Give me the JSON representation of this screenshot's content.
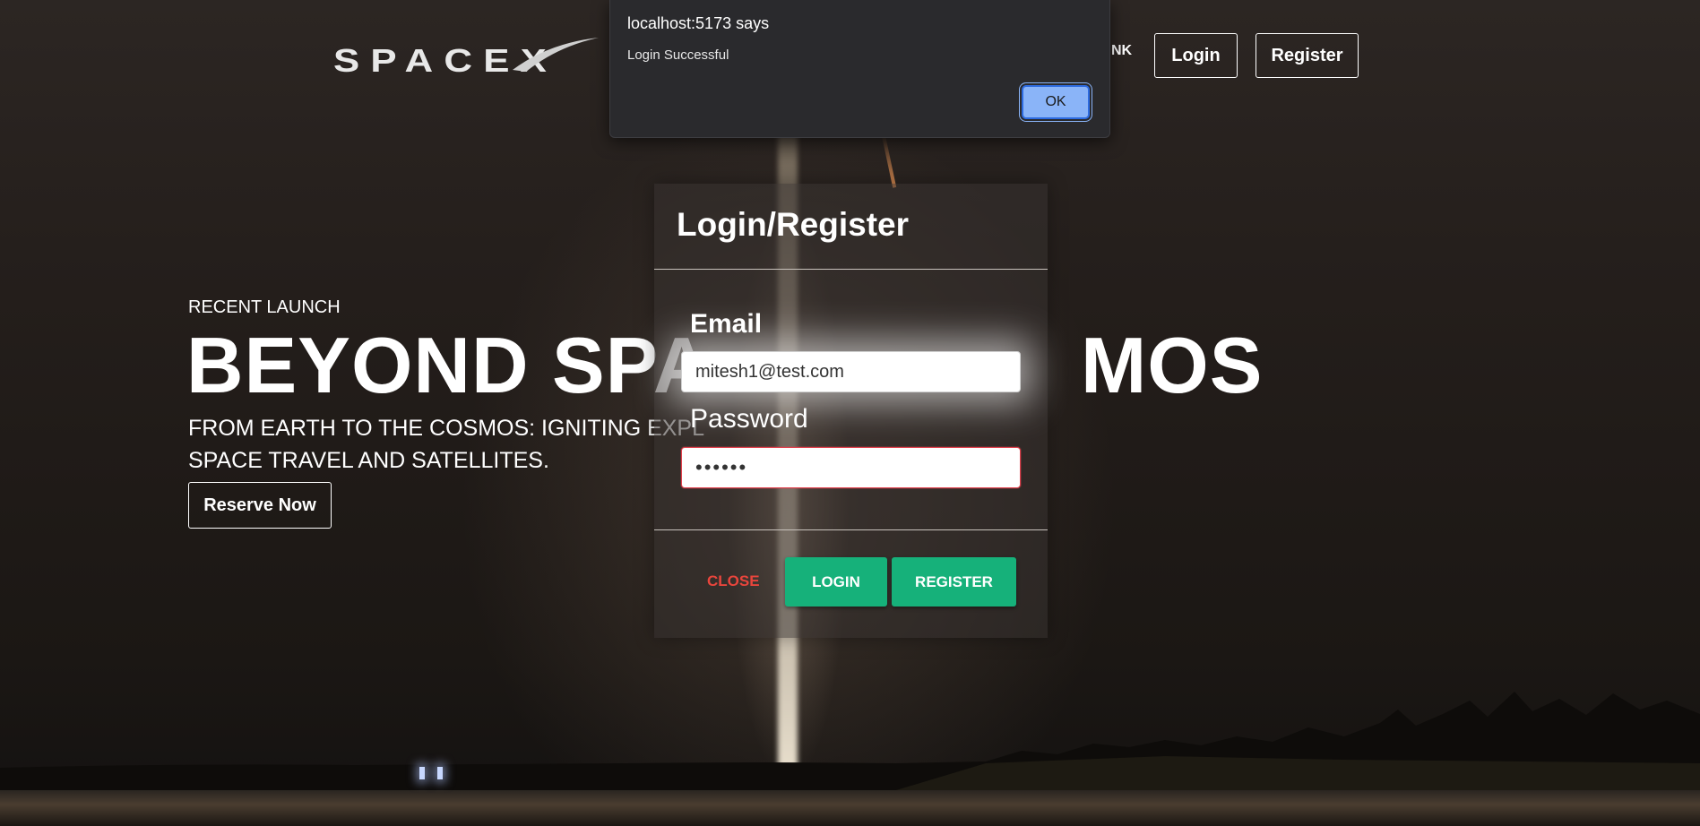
{
  "nav": {
    "brand": "SPACEX",
    "partial_link": "NK",
    "login_label": "Login",
    "register_label": "Register"
  },
  "hero": {
    "eyebrow": "RECENT LAUNCH",
    "title": "BEYOND SPA",
    "title_tail": "MOS",
    "subtitle_line1": "FROM EARTH TO THE COSMOS: IGNITING EXPL",
    "subtitle_line2": "SPACE TRAVEL AND SATELLITES.",
    "reserve_label": "Reserve Now"
  },
  "modal": {
    "title": "Login/Register",
    "email_label": "Email",
    "email_value": "mitesh1@test.com",
    "password_label": "Password",
    "password_value": "••••••",
    "close_label": "CLOSE",
    "login_label": "LOGIN",
    "register_label": "REGISTER"
  },
  "alert": {
    "title": "localhost:5173 says",
    "message": "Login Successful",
    "ok_label": "OK"
  },
  "colors": {
    "accent_green": "#16b17a",
    "close_red": "#e8453c",
    "alert_bg": "#2a2a2d",
    "alert_ok": "#8ab4f8",
    "error_border": "#e0404c"
  }
}
